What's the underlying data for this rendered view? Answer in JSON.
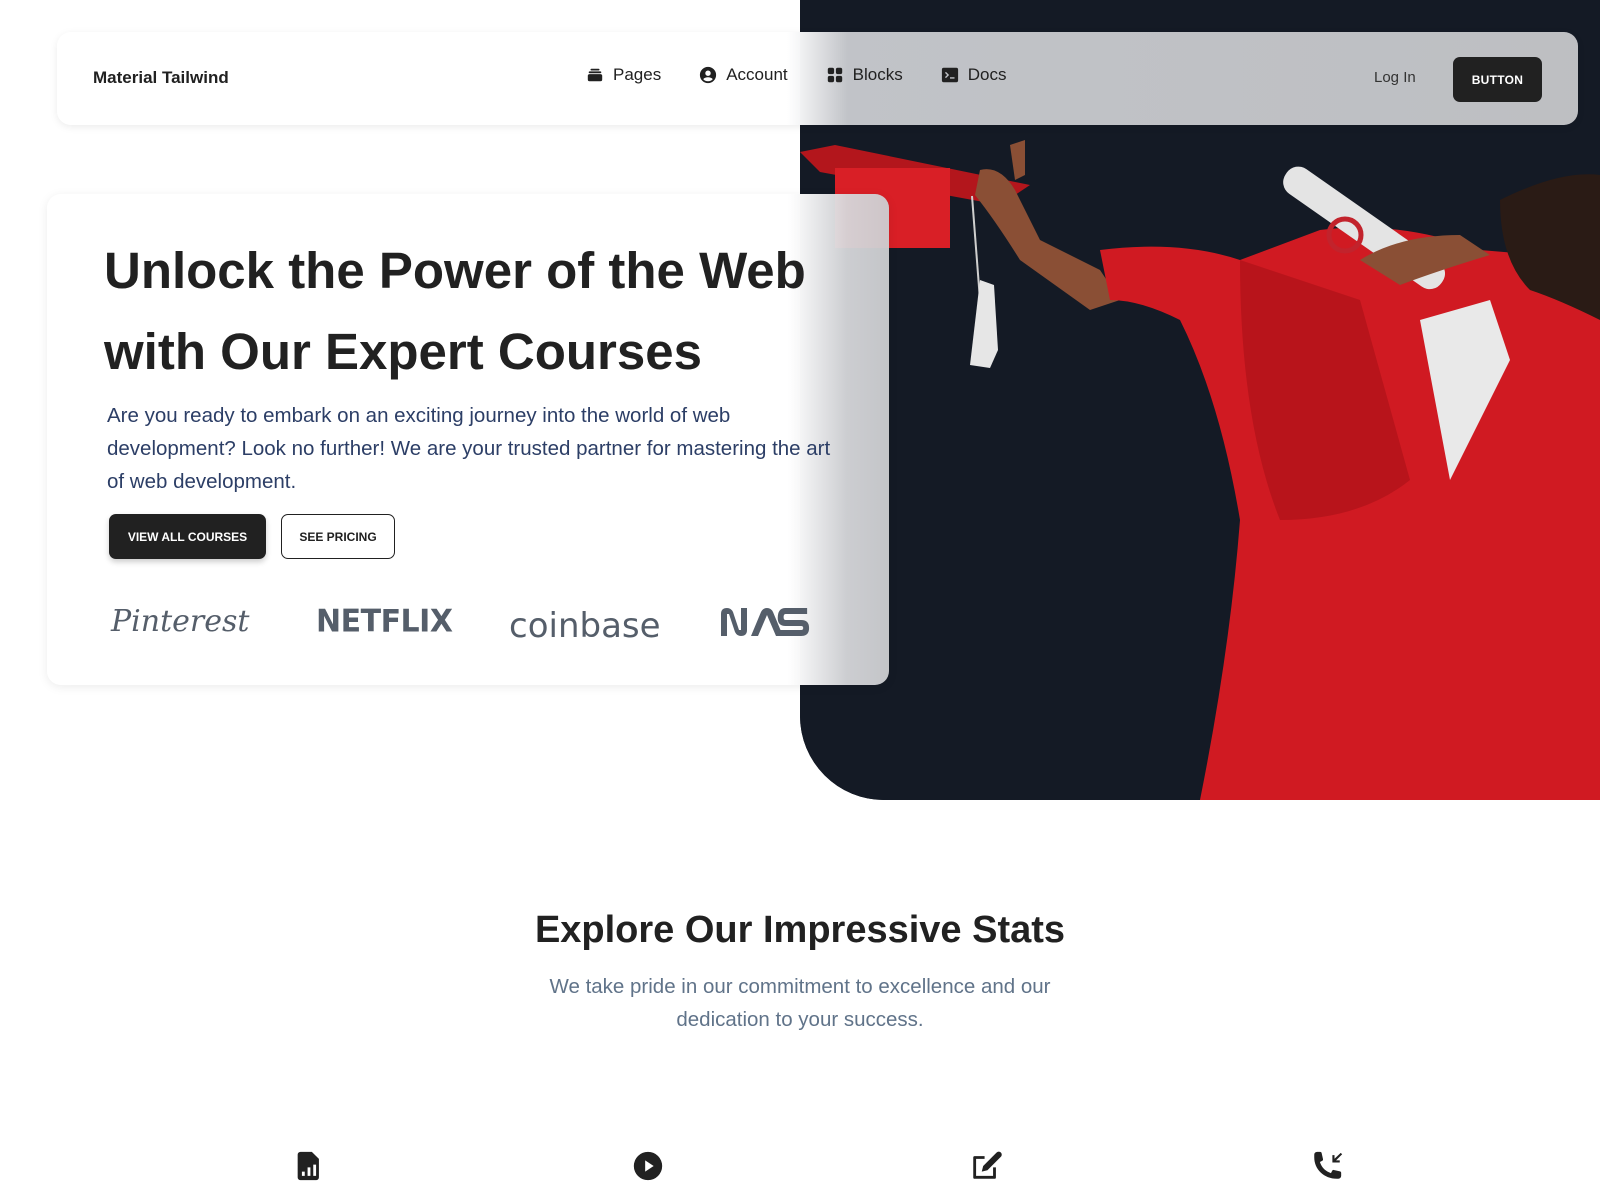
{
  "navbar": {
    "brand": "Material Tailwind",
    "links": [
      {
        "label": "Pages",
        "icon": "rectangle-stack-icon"
      },
      {
        "label": "Account",
        "icon": "user-circle-icon"
      },
      {
        "label": "Blocks",
        "icon": "squares-icon"
      },
      {
        "label": "Docs",
        "icon": "command-line-icon"
      }
    ],
    "login_label": "Log In",
    "button_label": "BUTTON"
  },
  "hero": {
    "title": "Unlock the Power of the Web with Our Expert Courses",
    "description": "Are you ready to embark on an exciting journey into the world of web development? Look no further! We are your trusted partner for mastering the art of web development.",
    "primary_button": "VIEW ALL COURSES",
    "secondary_button": "SEE PRICING",
    "logos": [
      "Pinterest",
      "NETFLIX",
      "coinbase",
      "NASA"
    ]
  },
  "stats": {
    "title": "Explore Our Impressive Stats",
    "subtitle": "We take pride in our commitment to excellence and our dedication to your success.",
    "icons": [
      "document-chart-icon",
      "play-circle-icon",
      "pencil-square-icon",
      "phone-arrow-icon"
    ]
  },
  "colors": {
    "primary": "#212121",
    "hero_bg": "#141a25",
    "accent_red": "#d91f26",
    "desc_text": "#2c3e66",
    "muted_text": "#607389"
  }
}
